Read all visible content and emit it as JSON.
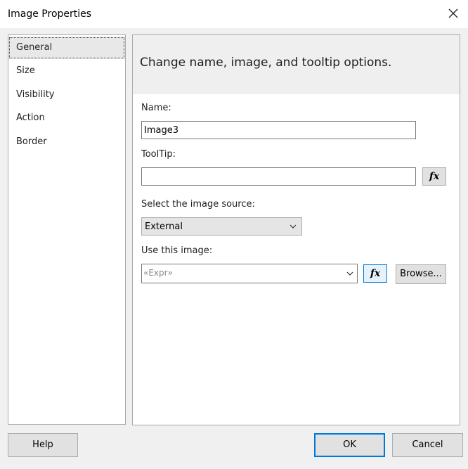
{
  "window": {
    "title": "Image Properties"
  },
  "sidebar": {
    "items": [
      {
        "label": "General",
        "selected": true
      },
      {
        "label": "Size"
      },
      {
        "label": "Visibility"
      },
      {
        "label": "Action"
      },
      {
        "label": "Border"
      }
    ]
  },
  "panel": {
    "heading": "Change name, image, and tooltip options.",
    "name": {
      "label": "Name:",
      "value": "Image3"
    },
    "tooltip": {
      "label": "ToolTip:",
      "value": ""
    },
    "image_source": {
      "label": "Select the image source:",
      "value": "External"
    },
    "use_image": {
      "label": "Use this image:",
      "value": "«Expr»"
    },
    "fx_label": "fx",
    "browse_label": "Browse..."
  },
  "footer": {
    "help": "Help",
    "ok": "OK",
    "cancel": "Cancel"
  },
  "icons": {
    "close": "close-icon",
    "dropdown": "chevron-down-icon"
  },
  "colors": {
    "accent": "#0078d7",
    "background": "#f0f0f0"
  }
}
